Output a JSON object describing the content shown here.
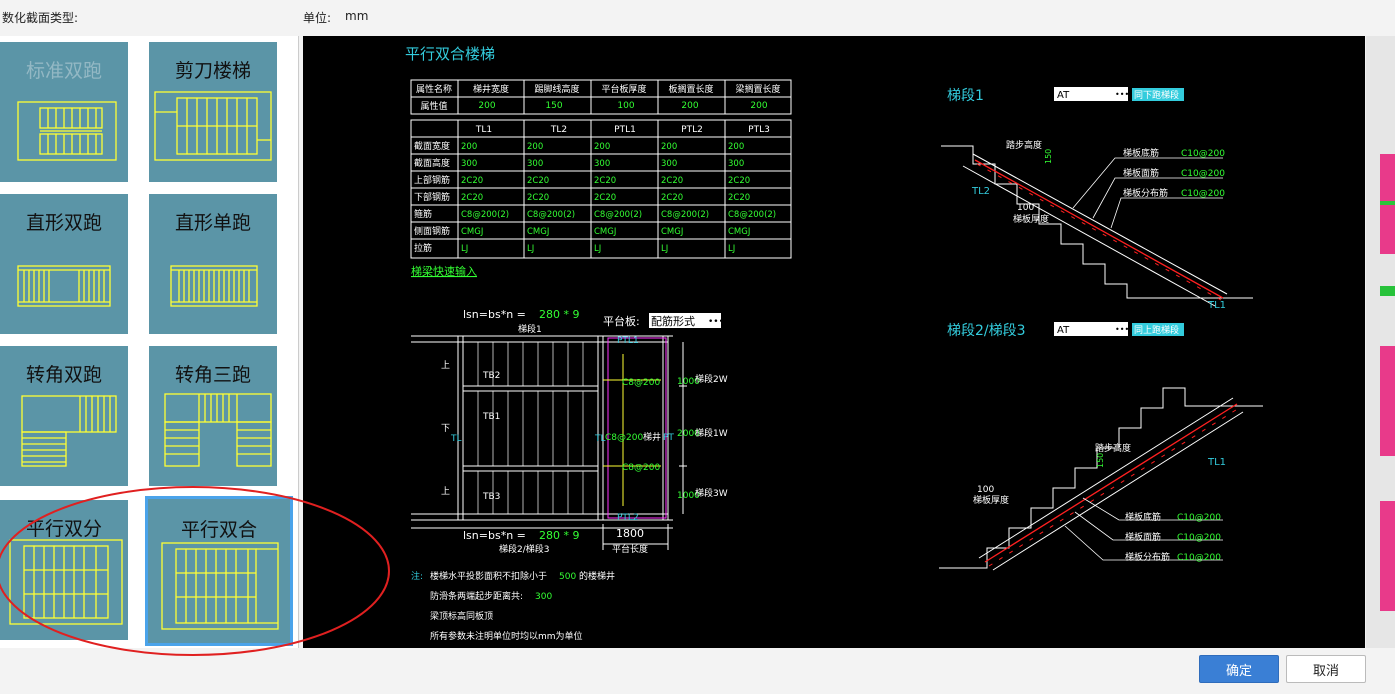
{
  "header": {
    "type_label": "数化截面类型:",
    "unit_label": "单位:",
    "unit_value": "mm"
  },
  "stair_types": [
    {
      "label": "标准双跑"
    },
    {
      "label": "剪刀楼梯"
    },
    {
      "label": "直形双跑"
    },
    {
      "label": "直形单跑"
    },
    {
      "label": "转角双跑"
    },
    {
      "label": "转角三跑"
    },
    {
      "label": "平行双分"
    },
    {
      "label": "平行双合"
    }
  ],
  "preview": {
    "title": "平行双合楼梯",
    "attr_table": {
      "headers": [
        "属性名称",
        "梯井宽度",
        "踢脚线高度",
        "平台板厚度",
        "板搁置长度",
        "梁搁置长度"
      ],
      "row_label": "属性值",
      "values": [
        "200",
        "150",
        "100",
        "200",
        "200"
      ]
    },
    "beam_table": {
      "headers": [
        "",
        "TL1",
        "TL2",
        "PTL1",
        "PTL2",
        "PTL3"
      ],
      "rows": [
        [
          "截面宽度",
          "200",
          "200",
          "200",
          "200",
          "200"
        ],
        [
          "截面高度",
          "300",
          "300",
          "300",
          "300",
          "300"
        ],
        [
          "上部钢筋",
          "2C20",
          "2C20",
          "2C20",
          "2C20",
          "2C20"
        ],
        [
          "下部钢筋",
          "2C20",
          "2C20",
          "2C20",
          "2C20",
          "2C20"
        ],
        [
          "箍筋",
          "C8@200(2)",
          "C8@200(2)",
          "C8@200(2)",
          "C8@200(2)",
          "C8@200(2)"
        ],
        [
          "侧面钢筋",
          "CMGJ",
          "CMGJ",
          "CMGJ",
          "CMGJ",
          "CMGJ"
        ],
        [
          "拉筋",
          "LJ",
          "LJ",
          "LJ",
          "LJ",
          "LJ"
        ]
      ]
    },
    "quick_input_link": "梯梁快速输入",
    "plan": {
      "lsn_label": "lsn=bs*n =",
      "lsn_value": "280 * 9",
      "run1_label": "梯段1",
      "run23_label": "梯段2/梯段3",
      "platform_label": "平台板:",
      "platform_value": "配筋形式",
      "platform_length_value": "1800",
      "platform_length_label": "平台长度",
      "ptl1": "PTL1",
      "ptl2": "PTL2",
      "tb1": "TB1",
      "tb2": "TB2",
      "tb3": "TB3",
      "up": "上",
      "down": "下",
      "rebar1": "C8@200",
      "rebar2": "C8@200",
      "rebar3": "C8@200",
      "rebar_v": "C8@200",
      "dim_top": "1000",
      "dim_mid": "2000",
      "dim_bot": "1000",
      "w2": "梯段2W",
      "w1": "梯段1W",
      "w3": "梯段3W",
      "well": "梯井",
      "tl_left": "TL",
      "tl_right": "TL",
      "pt": "PT"
    },
    "notes": {
      "prefix": "注:",
      "line1_a": "楼梯水平投影面积不扣除小于",
      "line1_v": "500",
      "line1_b": "的楼梯井",
      "line2_a": "防滑条两端起步距离共:",
      "line2_v": "300",
      "line3": "梁顶标高同板顶",
      "line4": "所有参数未注明单位时均以mm为单位"
    },
    "section1": {
      "title": "梯段1",
      "select_value": "AT",
      "same_btn": "同下跑梯段",
      "step_height": "踏步高度",
      "h150": "150",
      "thickness_val": "100",
      "thickness_label": "梯板厚度",
      "bottom_rebar_label": "梯板底筋",
      "bottom_rebar_value": "C10@200",
      "top_rebar_label": "梯板面筋",
      "top_rebar_value": "C10@200",
      "dist_rebar_label": "梯板分布筋",
      "dist_rebar_value": "C10@200",
      "tl_low": "TL2",
      "tl_high": "TL1"
    },
    "section2": {
      "title": "梯段2/梯段3",
      "select_value": "AT",
      "same_btn": "同上跑梯段",
      "step_height": "踏步高度",
      "h150": "150",
      "thickness_val": "100",
      "thickness_label": "梯板厚度",
      "bottom_rebar_label": "梯板底筋",
      "bottom_rebar_value": "C10@200",
      "top_rebar_label": "梯板面筋",
      "top_rebar_value": "C10@200",
      "dist_rebar_label": "梯板分布筋",
      "dist_rebar_value": "C10@200",
      "tl_high": "TL1"
    }
  },
  "buttons": {
    "ok": "确定",
    "cancel": "取消"
  },
  "colors": {
    "tile_bg": "#5b95a7",
    "line_yellow": "#ffff33",
    "text_cyan": "#33ccdd",
    "text_green": "#33ff33",
    "rebar_red": "#ff2020",
    "accent_blue": "#3a7fd5"
  }
}
